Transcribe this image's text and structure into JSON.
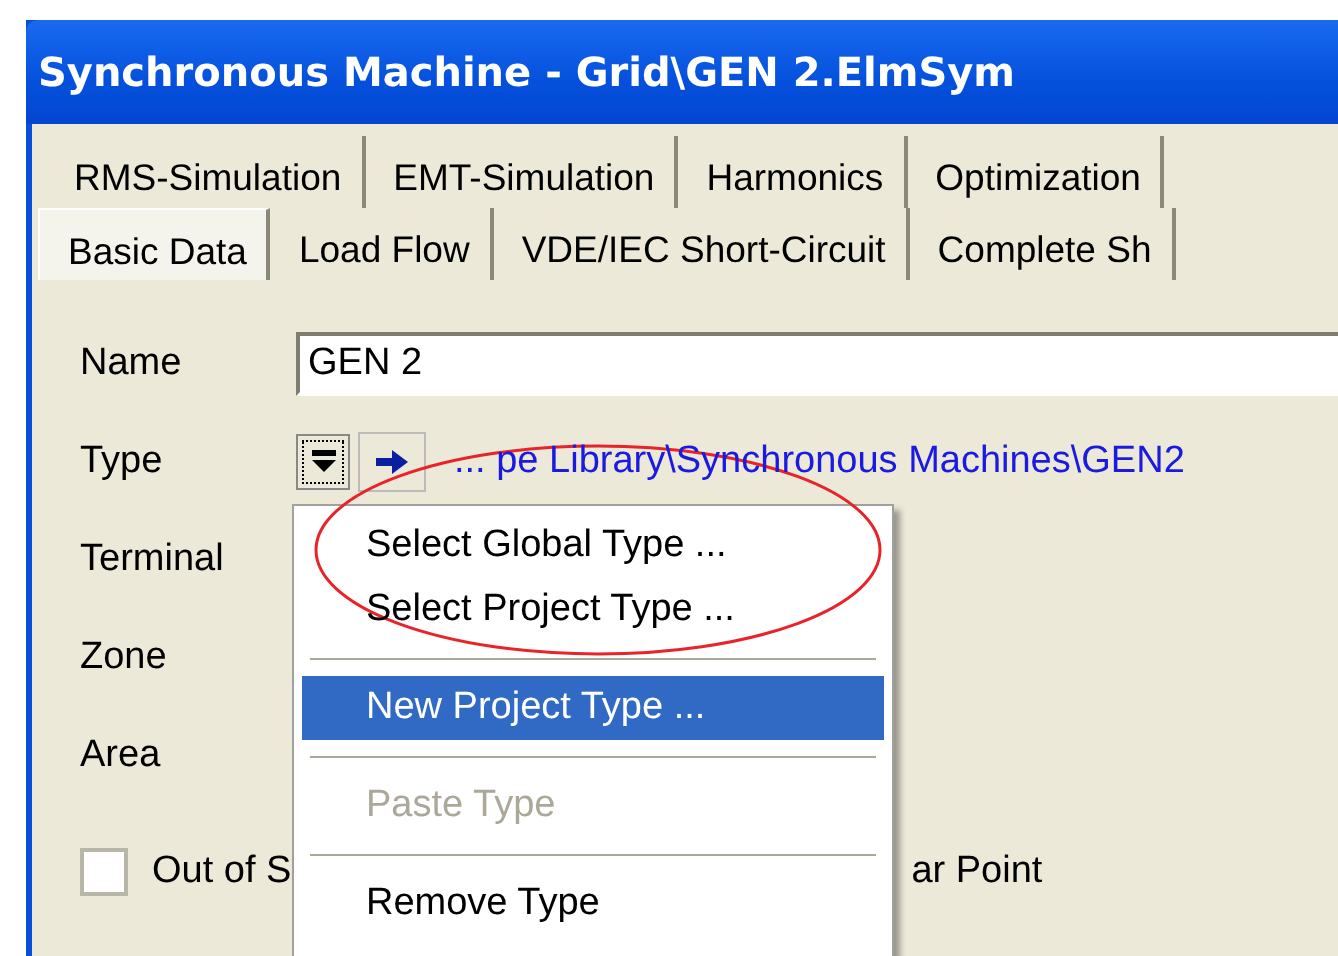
{
  "window": {
    "title": "Synchronous Machine - Grid\\GEN 2.ElmSym"
  },
  "tab_rows": [
    [
      {
        "label": "RMS-Simulation",
        "selected": false
      },
      {
        "label": "EMT-Simulation",
        "selected": false
      },
      {
        "label": "Harmonics",
        "selected": false
      },
      {
        "label": "Optimization",
        "selected": false
      }
    ],
    [
      {
        "label": "Basic Data",
        "selected": true
      },
      {
        "label": "Load Flow",
        "selected": false
      },
      {
        "label": "VDE/IEC Short-Circuit",
        "selected": false
      },
      {
        "label": "Complete Sh",
        "selected": false
      }
    ]
  ],
  "form": {
    "name_label": "Name",
    "name_value": "GEN 2",
    "type_label": "Type",
    "type_link": "... pe Library\\Synchronous Machines\\GEN2",
    "terminal_label": "Terminal",
    "zone_label": "Zone",
    "area_label": "Area",
    "checkbox": {
      "label_start": "Out of S",
      "label_end": "ar Point",
      "checked": false
    }
  },
  "type_menu": [
    {
      "kind": "item",
      "label": "Select Global Type ...",
      "selected": false,
      "disabled": false
    },
    {
      "kind": "item",
      "label": "Select Project Type ...",
      "selected": false,
      "disabled": false
    },
    {
      "kind": "separator"
    },
    {
      "kind": "item",
      "label": "New Project Type ...",
      "selected": true,
      "disabled": false
    },
    {
      "kind": "separator"
    },
    {
      "kind": "item",
      "label": "Paste Type",
      "selected": false,
      "disabled": true
    },
    {
      "kind": "separator"
    },
    {
      "kind": "item",
      "label": "Remove Type",
      "selected": false,
      "disabled": false
    }
  ]
}
